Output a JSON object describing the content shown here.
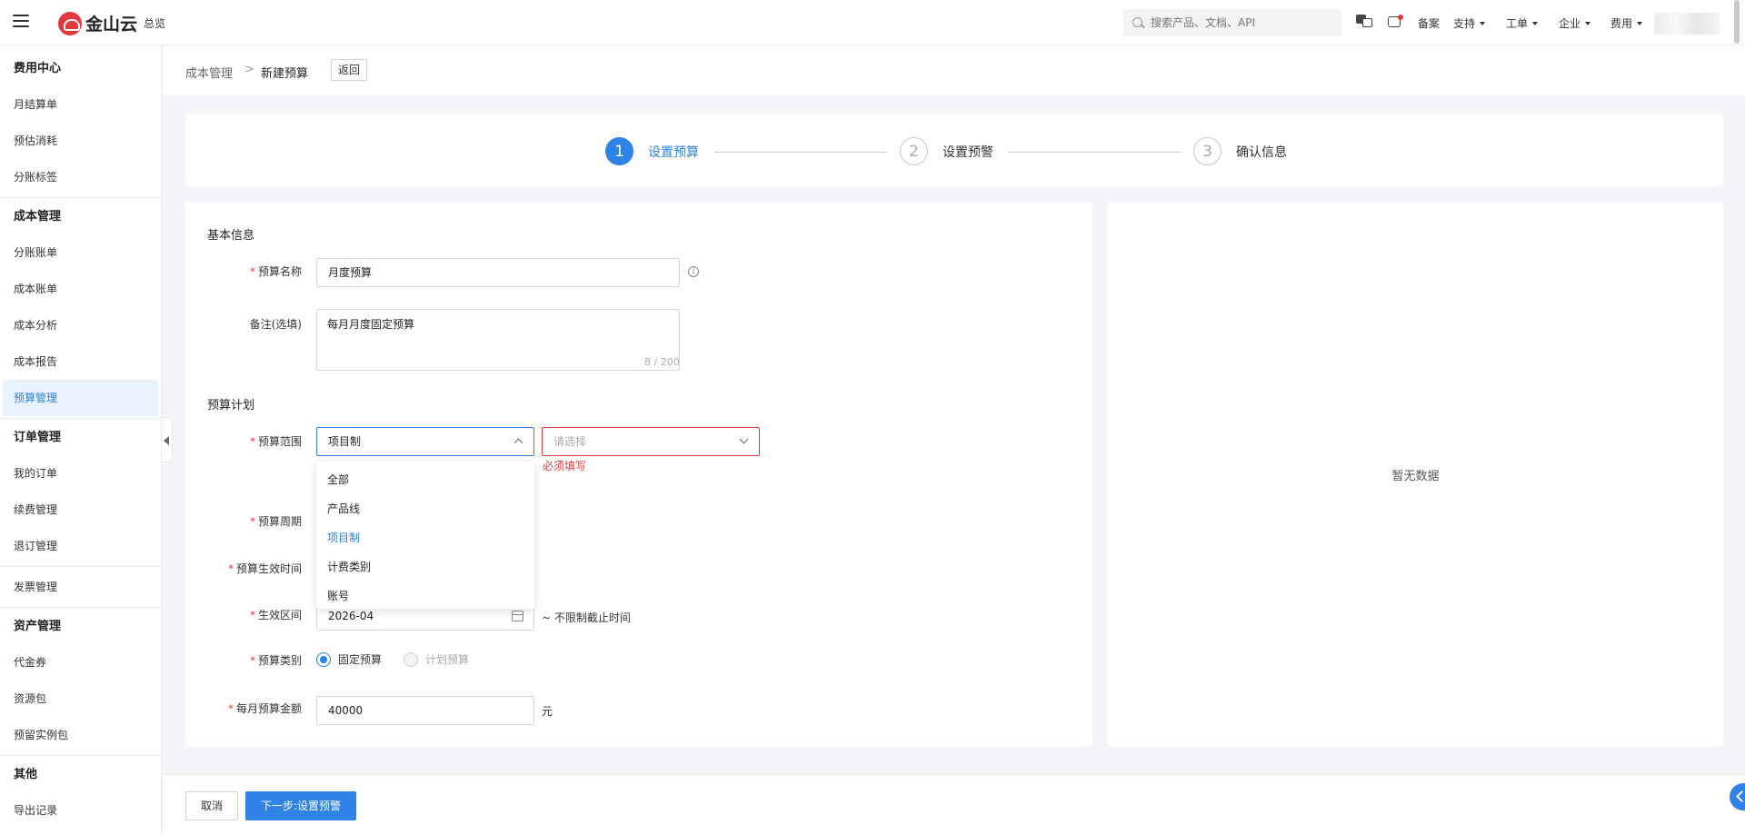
{
  "topbar": {
    "logo_text": "金山云",
    "overview": "总览",
    "search_placeholder": "搜索产品、文档、API",
    "links": [
      "备案",
      "支持",
      "工单",
      "企业",
      "费用"
    ]
  },
  "sidebar": {
    "groups": [
      {
        "title": "费用中心",
        "items": [
          "月结算单",
          "预估消耗",
          "分账标签"
        ]
      },
      {
        "title": "成本管理",
        "items": [
          "分账账单",
          "成本账单",
          "成本分析",
          "成本报告",
          "预算管理"
        ]
      },
      {
        "title": "订单管理",
        "items": [
          "我的订单",
          "续费管理",
          "退订管理"
        ]
      },
      {
        "title": "",
        "items": [
          "发票管理"
        ]
      },
      {
        "title": "资产管理",
        "items": [
          "代金券",
          "资源包",
          "预留实例包"
        ]
      },
      {
        "title": "其他",
        "items": [
          "导出记录"
        ]
      }
    ],
    "active": "预算管理"
  },
  "breadcrumb": {
    "parent": "成本管理",
    "separator": ">",
    "current": "新建预算",
    "back": "返回"
  },
  "steps": [
    {
      "num": "1",
      "label": "设置预算",
      "state": "active"
    },
    {
      "num": "2",
      "label": "设置预警",
      "state": "pending"
    },
    {
      "num": "3",
      "label": "确认信息",
      "state": "pending"
    }
  ],
  "form": {
    "basic_title": "基本信息",
    "name_label": "预算名称",
    "name_value": "月度预算",
    "info_icon": "i",
    "remark_label": "备注(选填)",
    "remark_value": "每月月度固定预算",
    "remark_count": "8 / 200",
    "plan_title": "预算计划",
    "scope_label": "预算范围",
    "scope_value": "项目制",
    "scope2_placeholder": "请选择",
    "scope_error": "必须填写",
    "scope_options": [
      "全部",
      "产品线",
      "项目制",
      "计费类别",
      "账号"
    ],
    "period_label": "预算周期",
    "effective_time_label": "预算生效时间",
    "range_label": "生效区间",
    "range_value": "2026-04",
    "range_suffix": "~ 不限制截止时间",
    "type_label": "预算类别",
    "type_fixed": "固定预算",
    "type_plan": "计划预算",
    "amount_label": "每月预算金额",
    "amount_value": "40000",
    "amount_unit": "元"
  },
  "side": {
    "empty": "暂无数据"
  },
  "footer": {
    "cancel": "取消",
    "next": "下一步:设置预警"
  },
  "colors": {
    "primary": "#2f82e6",
    "error": "#e4393c",
    "brand": "#e4393c"
  }
}
